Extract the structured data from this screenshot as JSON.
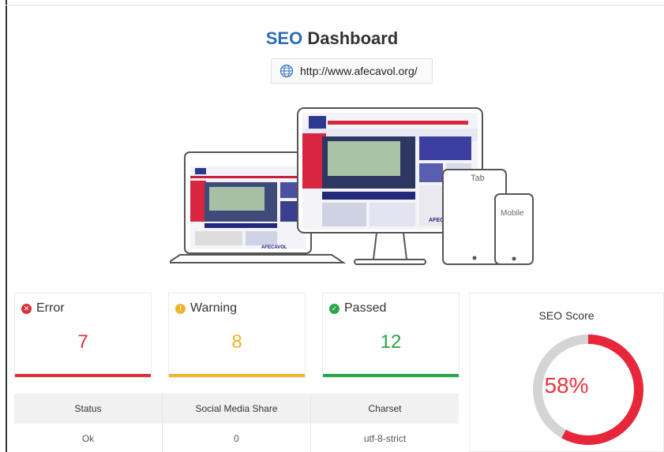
{
  "header": {
    "title_accent": "SEO",
    "title_rest": " Dashboard",
    "url": "http://www.afecavol.org/",
    "url_icon": "globe-icon"
  },
  "preview": {
    "tablet_alt": "Tab",
    "mobile_alt": "Mobile",
    "site_name": "AFECAVOL"
  },
  "cards": [
    {
      "label": "Error",
      "value": "7",
      "icon": "x-circle-icon",
      "color": "#d9323d"
    },
    {
      "label": "Warning",
      "value": "8",
      "icon": "exclamation-circle-icon",
      "color": "#f0b42a"
    },
    {
      "label": "Passed",
      "value": "12",
      "icon": "check-circle-icon",
      "color": "#27a844"
    }
  ],
  "table": {
    "headers": [
      "Status",
      "Social Media Share",
      "Charset"
    ],
    "rows": [
      [
        "Ok",
        "0",
        "utf-8-strict"
      ]
    ]
  },
  "seo_score": {
    "label": "SEO Score",
    "value_text": "58%",
    "fraction": 0.58,
    "ring_color": "#e8263a",
    "track_color": "#d4d4d4"
  }
}
